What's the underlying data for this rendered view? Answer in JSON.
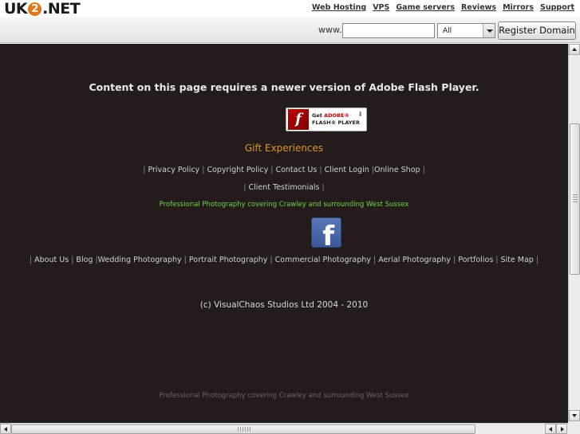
{
  "topbar": {
    "logo": {
      "prefix": "UK",
      "digit": "2",
      "suffix": ".NET"
    },
    "links": [
      "Web Hosting",
      "VPS",
      "Game servers",
      "Reviews",
      "Mirrors",
      "Support"
    ]
  },
  "domainbar": {
    "www_label": "www.",
    "domain_value": "",
    "tld_selected": "All",
    "register_label": "Register Domain"
  },
  "content": {
    "flash_message": "Content on this page requires a newer version of Adobe Flash Player.",
    "flash_badge": {
      "line1_prefix": "Get ",
      "line1_brand": "ADOBE®",
      "line2": "FLASH® PLAYER"
    },
    "gift": "Gift Experiences",
    "links_row1": [
      "Privacy Policy",
      "Copyright Policy",
      "Contact Us",
      "Client Login",
      "Online Shop"
    ],
    "links_row2": [
      "Client Testimonials"
    ],
    "promo_green": "Professional Photography covering Crawley and surrounding West Sussex",
    "links_row3": [
      "About Us",
      "Blog",
      "Wedding Photography",
      "Portrait Photography",
      "Commercial Photography",
      "Aerial Photography",
      "Portfolios",
      "Site Map"
    ],
    "copyright": "(c) VisualChaos Studios Ltd 2004 - 2010",
    "promo_dim": "Professional Photography covering Crawley and surrounding West Sussex"
  },
  "colors": {
    "content_bg": "#231c1b",
    "gift": "#e0922a",
    "promo_green": "#6fd24c",
    "facebook": "#3b5998"
  },
  "icons": [
    "flash-player-icon",
    "facebook-icon",
    "up-arrow-icon",
    "down-arrow-icon",
    "left-arrow-icon",
    "right-arrow-icon"
  ]
}
